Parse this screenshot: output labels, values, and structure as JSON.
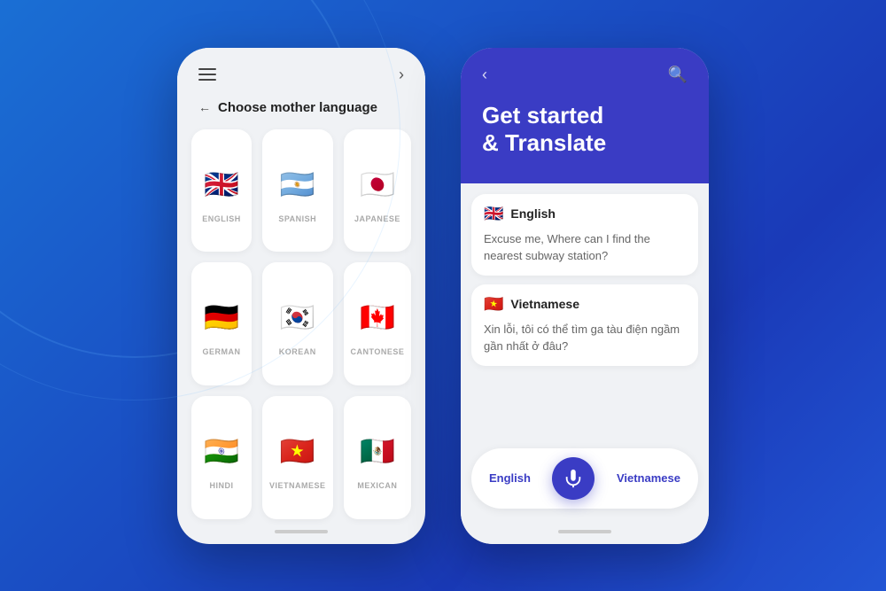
{
  "background": {
    "gradient_start": "#1a6fd4",
    "gradient_end": "#1a3ab8"
  },
  "phone1": {
    "header": {
      "menu_label": "menu",
      "forward_label": "›"
    },
    "title_section": {
      "back_arrow": "←",
      "title": "Choose mother language"
    },
    "languages": [
      {
        "id": "english",
        "label": "ENGLISH",
        "emoji": "🇬🇧",
        "bg": "#012169"
      },
      {
        "id": "spanish",
        "label": "SPANISH",
        "emoji": "🇦🇷",
        "bg": "#74ACDF"
      },
      {
        "id": "japanese",
        "label": "JAPANESE",
        "emoji": "🇯🇵",
        "bg": "#fff"
      },
      {
        "id": "german",
        "label": "GERMAN",
        "emoji": "🇩🇪",
        "bg": "#000"
      },
      {
        "id": "korean",
        "label": "KOREAN",
        "emoji": "🇰🇷",
        "bg": "#fff"
      },
      {
        "id": "cantonese",
        "label": "CANTONESE",
        "emoji": "🇨🇦",
        "bg": "#FF0000"
      },
      {
        "id": "hindi",
        "label": "HINDI",
        "emoji": "🇮🇳",
        "bg": "#FF9933"
      },
      {
        "id": "vietnamese",
        "label": "VIETNAMESE",
        "emoji": "🇻🇳",
        "bg": "#DA251D"
      },
      {
        "id": "mexican",
        "label": "MEXICAN",
        "emoji": "🇲🇽",
        "bg": "#006847"
      }
    ]
  },
  "phone2": {
    "header": {
      "back_label": "‹",
      "search_label": "search"
    },
    "title": "Get started\n& Translate",
    "english_card": {
      "flag": "🇬🇧",
      "lang": "English",
      "text": "Excuse me, Where can I find the nearest subway station?"
    },
    "vietnamese_card": {
      "flag": "🇻🇳",
      "lang": "Vietnamese",
      "text": "Xin lỗi, tôi có thể tìm ga tàu điện ngầm gần nhất ở đâu?"
    },
    "controls": {
      "left_lang": "English",
      "mic_icon": "🎤",
      "right_lang": "Vietnamese"
    }
  }
}
